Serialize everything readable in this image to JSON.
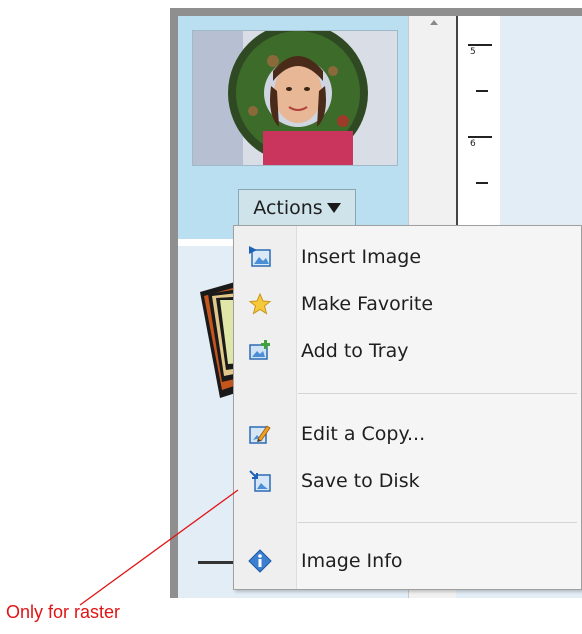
{
  "actions_button": {
    "label": "Actions"
  },
  "menu": {
    "items": [
      {
        "label": "Insert Image",
        "icon": "insert-image-icon"
      },
      {
        "label": "Make Favorite",
        "icon": "star-icon"
      },
      {
        "label": "Add to Tray",
        "icon": "add-to-tray-icon"
      },
      {
        "label": "Edit a Copy...",
        "icon": "edit-copy-icon"
      },
      {
        "label": "Save to Disk",
        "icon": "save-to-disk-icon"
      },
      {
        "label": "Image Info",
        "icon": "info-icon"
      }
    ]
  },
  "ruler": {
    "marks": [
      "5",
      "6"
    ]
  },
  "annotation": {
    "text": "Only for raster",
    "color": "#e01414"
  },
  "colors": {
    "thumb_panel": "#b9dff0",
    "menu_bg": "#f5f5f5",
    "frame": "#8f8f8f"
  }
}
